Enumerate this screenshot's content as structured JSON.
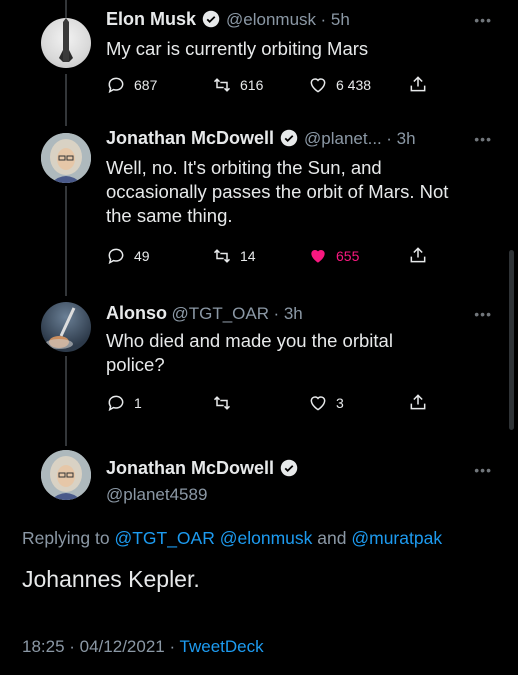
{
  "tweets": [
    {
      "name": "Elon Musk",
      "handle": "@elonmusk",
      "time": "· 5h",
      "lines": [
        "My car is currently orbiting Mars"
      ],
      "replies": "687",
      "retweets": "616",
      "likes": "6 438"
    },
    {
      "name": "Jonathan McDowell",
      "handle": "@planet...",
      "time": "· 3h",
      "lines": [
        "Well, no. It's orbiting the Sun, and",
        "occasionally passes the orbit of Mars. Not",
        "the same thing."
      ],
      "replies": "49",
      "retweets": "14",
      "likes": "655"
    },
    {
      "name": "Alonso",
      "handle": "@TGT_OAR",
      "time": "· 3h",
      "lines": [
        "Who died and made you the orbital",
        "police?"
      ],
      "replies": "1",
      "retweets": "",
      "likes": "3"
    }
  ],
  "main_tweet": {
    "name": "Jonathan McDowell",
    "handle": "@planet4589",
    "replying_prefix": "Replying to",
    "replying_to_1": "@TGT_OAR",
    "replying_to_2": "@elonmusk",
    "replying_and": "and",
    "replying_to_3": "@muratpak",
    "text": "Johannes Kepler.",
    "timestamp": "18:25 · 04/12/2021 ·",
    "source": "TweetDeck"
  },
  "more_label": "•••",
  "colors": {
    "accent": "#1d9bf0",
    "like_active": "#f91880",
    "muted": "#8b98a5"
  },
  "icons": [
    "reply-icon",
    "retweet-icon",
    "like-icon",
    "share-icon",
    "verified-icon",
    "more-icon"
  ]
}
